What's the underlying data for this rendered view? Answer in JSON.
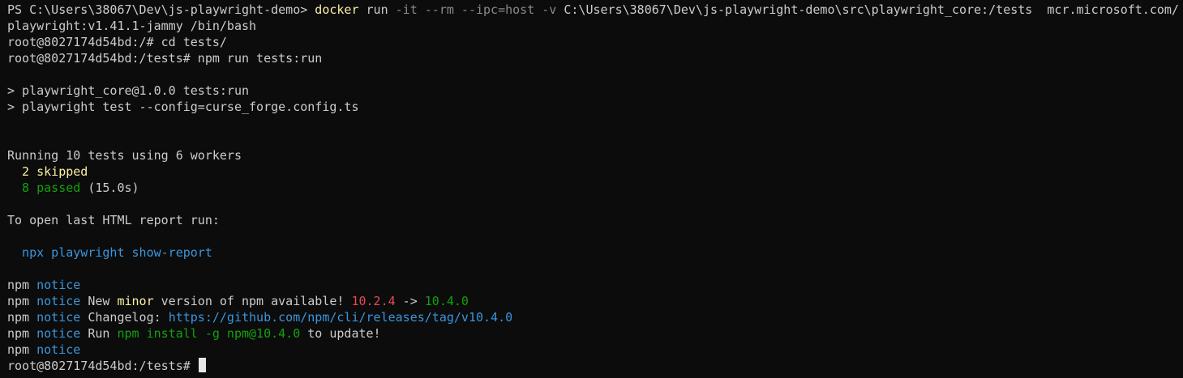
{
  "colors": {
    "background": "#0c0c0c",
    "default": "#cccccc",
    "yellow": "#f9f1a5",
    "gray": "#8a8a8a",
    "cyan": "#3a96dd",
    "green": "#16c60c",
    "green_dim": "#13a10e",
    "red": "#e74856",
    "cursor": "#e6e6e6"
  },
  "terminal": {
    "lines": [
      {
        "segments": [
          {
            "text": "PS C:\\Users\\38067\\Dev\\js-playwright-demo> ",
            "color": "default"
          },
          {
            "text": "docker",
            "color": "yellow"
          },
          {
            "text": " run",
            "color": "default"
          },
          {
            "text": " -it --rm --ipc=host -v",
            "color": "gray"
          },
          {
            "text": " C:\\Users\\38067\\Dev\\js-playwright-demo\\src\\playwright_core:/tests  mcr.microsoft.com/",
            "color": "default"
          }
        ]
      },
      {
        "segments": [
          {
            "text": "playwright:v1.41.1-jammy /bin/bash",
            "color": "default"
          }
        ]
      },
      {
        "segments": [
          {
            "text": "root@8027174d54bd:/# cd tests/",
            "color": "default"
          }
        ]
      },
      {
        "segments": [
          {
            "text": "root@8027174d54bd:/tests# npm run tests:run",
            "color": "default"
          }
        ]
      },
      {
        "segments": [
          {
            "text": "",
            "color": "default"
          }
        ]
      },
      {
        "segments": [
          {
            "text": "> playwright_core@1.0.0 tests:run",
            "color": "default"
          }
        ]
      },
      {
        "segments": [
          {
            "text": "> playwright test --config=curse_forge.config.ts",
            "color": "default"
          }
        ]
      },
      {
        "segments": [
          {
            "text": "",
            "color": "default"
          }
        ]
      },
      {
        "segments": [
          {
            "text": "",
            "color": "default"
          }
        ]
      },
      {
        "segments": [
          {
            "text": "Running 10 tests using 6 workers",
            "color": "default"
          }
        ]
      },
      {
        "segments": [
          {
            "text": "  2 skipped",
            "color": "yellow"
          }
        ]
      },
      {
        "segments": [
          {
            "text": "  8 passed",
            "color": "green_dim"
          },
          {
            "text": " (15.0s)",
            "color": "default"
          }
        ]
      },
      {
        "segments": [
          {
            "text": "",
            "color": "default"
          }
        ]
      },
      {
        "segments": [
          {
            "text": "To open last HTML report run:",
            "color": "default"
          }
        ]
      },
      {
        "segments": [
          {
            "text": "",
            "color": "default"
          }
        ]
      },
      {
        "segments": [
          {
            "text": "  npx playwright show-report",
            "color": "cyan"
          }
        ]
      },
      {
        "segments": [
          {
            "text": "",
            "color": "default"
          }
        ]
      },
      {
        "segments": [
          {
            "text": "npm ",
            "color": "default"
          },
          {
            "text": "notice",
            "color": "cyan"
          }
        ]
      },
      {
        "segments": [
          {
            "text": "npm ",
            "color": "default"
          },
          {
            "text": "notice",
            "color": "cyan"
          },
          {
            "text": " New ",
            "color": "default"
          },
          {
            "text": "minor",
            "color": "yellow"
          },
          {
            "text": " version of npm available! ",
            "color": "default"
          },
          {
            "text": "10.2.4",
            "color": "red"
          },
          {
            "text": " -> ",
            "color": "default"
          },
          {
            "text": "10.4.0",
            "color": "green_dim"
          }
        ]
      },
      {
        "segments": [
          {
            "text": "npm ",
            "color": "default"
          },
          {
            "text": "notice",
            "color": "cyan"
          },
          {
            "text": " Changelog: ",
            "color": "default"
          },
          {
            "text": "https://github.com/npm/cli/releases/tag/v10.4.0",
            "color": "cyan"
          }
        ]
      },
      {
        "segments": [
          {
            "text": "npm ",
            "color": "default"
          },
          {
            "text": "notice",
            "color": "cyan"
          },
          {
            "text": " Run ",
            "color": "default"
          },
          {
            "text": "npm install -g npm@10.4.0",
            "color": "green_dim"
          },
          {
            "text": " to update!",
            "color": "default"
          }
        ]
      },
      {
        "segments": [
          {
            "text": "npm ",
            "color": "default"
          },
          {
            "text": "notice",
            "color": "cyan"
          }
        ]
      },
      {
        "segments": [
          {
            "text": "root@8027174d54bd:/tests# ",
            "color": "default"
          }
        ],
        "cursor": true
      }
    ]
  }
}
